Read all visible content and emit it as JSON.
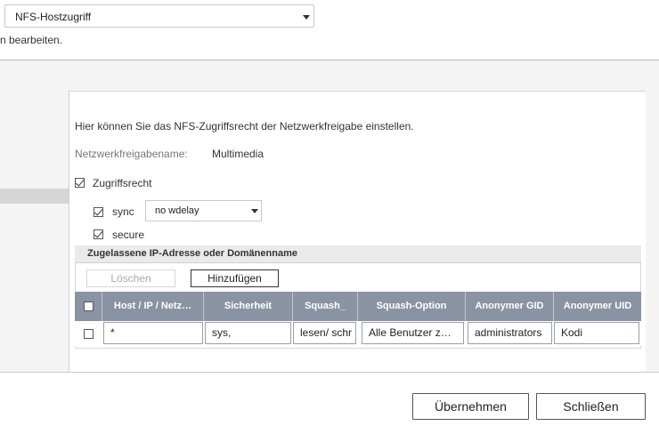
{
  "top_select": {
    "value": "NFS-Hostzugriff"
  },
  "hint_text": "n bearbeiten.",
  "description": "Hier können Sie das NFS-Zugriffsrecht der Netzwerkfreigabe einstellen.",
  "share": {
    "label": "Netzwerkfreigabename:",
    "value": "Multimedia"
  },
  "access": {
    "label": "Zugriffsrecht",
    "checked": true
  },
  "sync": {
    "label": "sync",
    "checked": true,
    "option": "no wdelay"
  },
  "secure": {
    "label": "secure",
    "checked": true
  },
  "grid": {
    "title": "Zugelassene IP-Adresse oder Domänenname",
    "delete_label": "Löschen",
    "add_label": "Hinzufügen",
    "columns": [
      "Host / IP / Netz…",
      "Sicherheit",
      "Squash_",
      "Squash-Option",
      "Anonymer GID",
      "Anonymer UID"
    ],
    "row": [
      "*",
      "sys,",
      "lesen/ schr",
      "Alle Benutzer z…",
      "administrators",
      "Kodi"
    ]
  },
  "buttons": {
    "apply": "Übernehmen",
    "close": "Schließen"
  }
}
